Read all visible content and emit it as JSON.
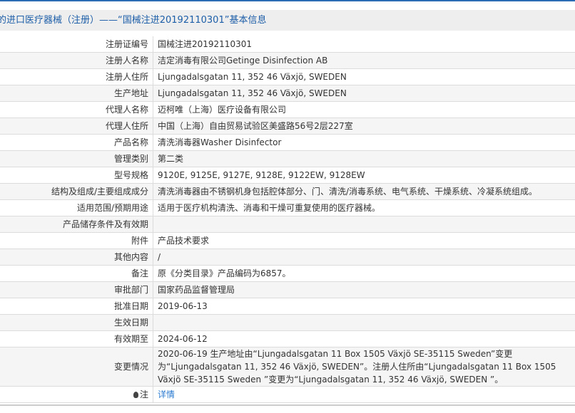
{
  "title": "的进口医疗器械（注册）——“国械注进20192110301”基本信息",
  "rows": [
    {
      "label": "注册证编号",
      "value": "国械注进20192110301"
    },
    {
      "label": "注册人名称",
      "value": "洁定消毒有限公司Getinge Disinfection AB"
    },
    {
      "label": "注册人住所",
      "value": "Ljungadalsgatan 11, 352 46 Växjö, SWEDEN"
    },
    {
      "label": "生产地址",
      "value": "Ljungadalsgatan 11, 352 46 Växjö, SWEDEN"
    },
    {
      "label": "代理人名称",
      "value": "迈柯唯（上海）医疗设备有限公司"
    },
    {
      "label": "代理人住所",
      "value": "中国（上海）自由贸易试验区美盛路56号2层227室"
    },
    {
      "label": "产品名称",
      "value": "清洗消毒器Washer Disinfector"
    },
    {
      "label": "管理类别",
      "value": "第二类"
    },
    {
      "label": "型号规格",
      "value": "9120E, 9125E, 9127E, 9128E, 9122EW, 9128EW"
    },
    {
      "label": "结构及组成/主要组成成分",
      "value": "清洗消毒器由不锈钢机身包括腔体部分、门、清洗/消毒系统、电气系统、干燥系统、冷凝系统组成。"
    },
    {
      "label": "适用范围/预期用途",
      "value": "适用于医疗机构清洗、消毒和干燥可重复使用的医疗器械。"
    },
    {
      "label": "产品储存条件及有效期",
      "value": ""
    },
    {
      "label": "附件",
      "value": "产品技术要求"
    },
    {
      "label": "其他内容",
      "value": "/"
    },
    {
      "label": "备注",
      "value": "原《分类目录》产品编码为6857。"
    },
    {
      "label": "审批部门",
      "value": "国家药品监督管理局"
    },
    {
      "label": "批准日期",
      "value": "2019-06-13"
    },
    {
      "label": "生效日期",
      "value": ""
    },
    {
      "label": "有效期至",
      "value": "2024-06-12"
    },
    {
      "label": "变更情况",
      "value": "2020-06-19 生产地址由“Ljungadalsgatan 11 Box 1505 Växjö SE-35115 Sweden”变更为“Ljungadalsgatan 11, 352 46 Växjö, SWEDEN”。注册人住所由“Ljungadalsgatan 11 Box 1505 Växjö SE-35115 Sweden ”变更为“Ljungadalsgatan 11, 352 46 Växjö, SWEDEN ”。"
    }
  ],
  "note": {
    "label": "注",
    "link": "详情"
  }
}
